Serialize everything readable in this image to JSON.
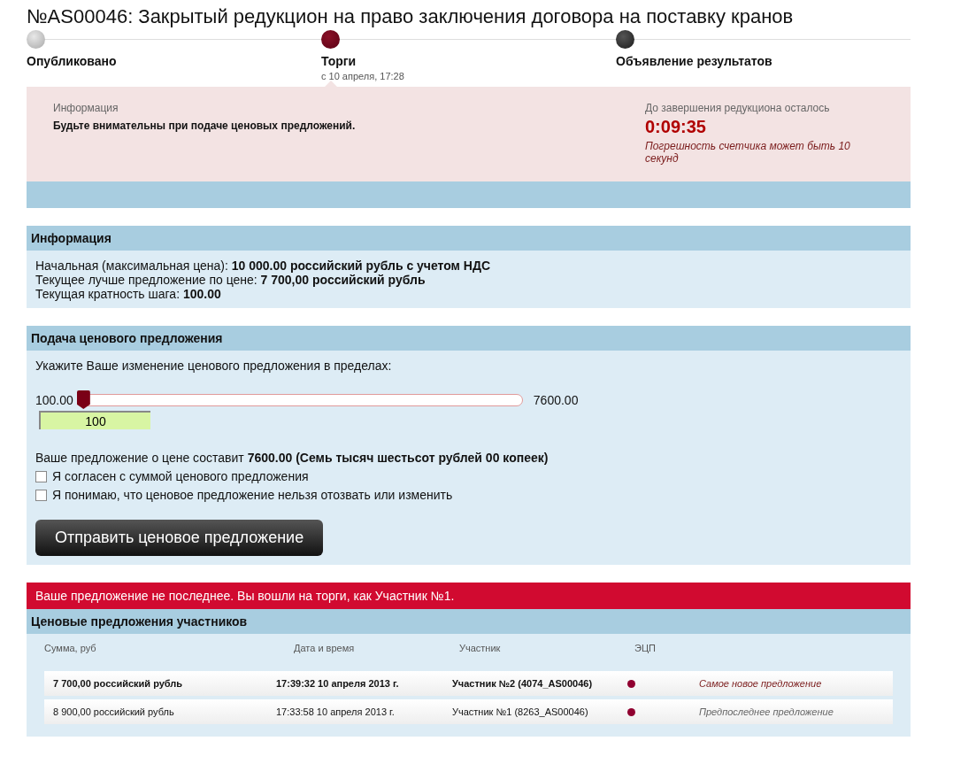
{
  "title": "№AS00046: Закрытый редукцион на право заключения договора на поставку кранов",
  "steps": [
    {
      "label": "Опубликовано",
      "kind": "done"
    },
    {
      "label": "Торги",
      "kind": "current",
      "date": "с 10 апреля, 17:28"
    },
    {
      "label": "Объявление результатов",
      "kind": "upcoming"
    }
  ],
  "notice": {
    "heading": "Информация",
    "text": "Будьте внимательны при подаче ценовых предложений.",
    "timer_label": "До завершения редукциона осталось",
    "timer": "0:09:35",
    "timer_note": "Погрешность счетчика может быть 10 секунд"
  },
  "info": {
    "heading": "Информация",
    "lines": [
      "Начальная (максимальная цена): **10 000.00 российский рубль с учетом НДС**",
      "Текущее лучше предложение по цене: **7 700,00 российский рубль**",
      "Текущая кратность шага: **100.00**"
    ]
  },
  "bid": {
    "heading": "Подача ценового предложения",
    "prompt": "Укажите Ваше изменение ценового предложения в пределах:",
    "min": "100.00",
    "max": "7600.00",
    "level": 0,
    "value": "100",
    "summary": "Ваше предложение о цене составит **7600.00 (Семь тысяч шестьсот рублей 00 копеек)**",
    "checkboxes": [
      {
        "label": "Я согласен с суммой ценового предложения",
        "checked": false
      },
      {
        "label": "Я понимаю, что ценовое предложение нельзя отозвать или изменить",
        "checked": false
      }
    ],
    "submit": "Отправить ценовое предложение"
  },
  "alert": "Ваше предложение не последнее. Вы вошли на торги, как Участник №1.",
  "offers": {
    "heading": "Ценовые предложения участников",
    "columns": [
      "Сумма, руб",
      "Дата и время",
      "Участник",
      "ЭЦП"
    ],
    "rows": [
      {
        "amount": "7 700,00 российский рубль",
        "datetime": "17:39:32 10 апреля 2013 г.",
        "participant": "Участник №2 (4074_AS00046)",
        "signed": true,
        "note": "Самое новое предложение",
        "latest": true
      },
      {
        "amount": "8 900,00 российский рубль",
        "datetime": "17:33:58 10 апреля 2013 г.",
        "participant": "Участник №1 (8263_AS00046)",
        "signed": true,
        "note": "Предпоследнее предложение",
        "latest": false
      }
    ]
  }
}
